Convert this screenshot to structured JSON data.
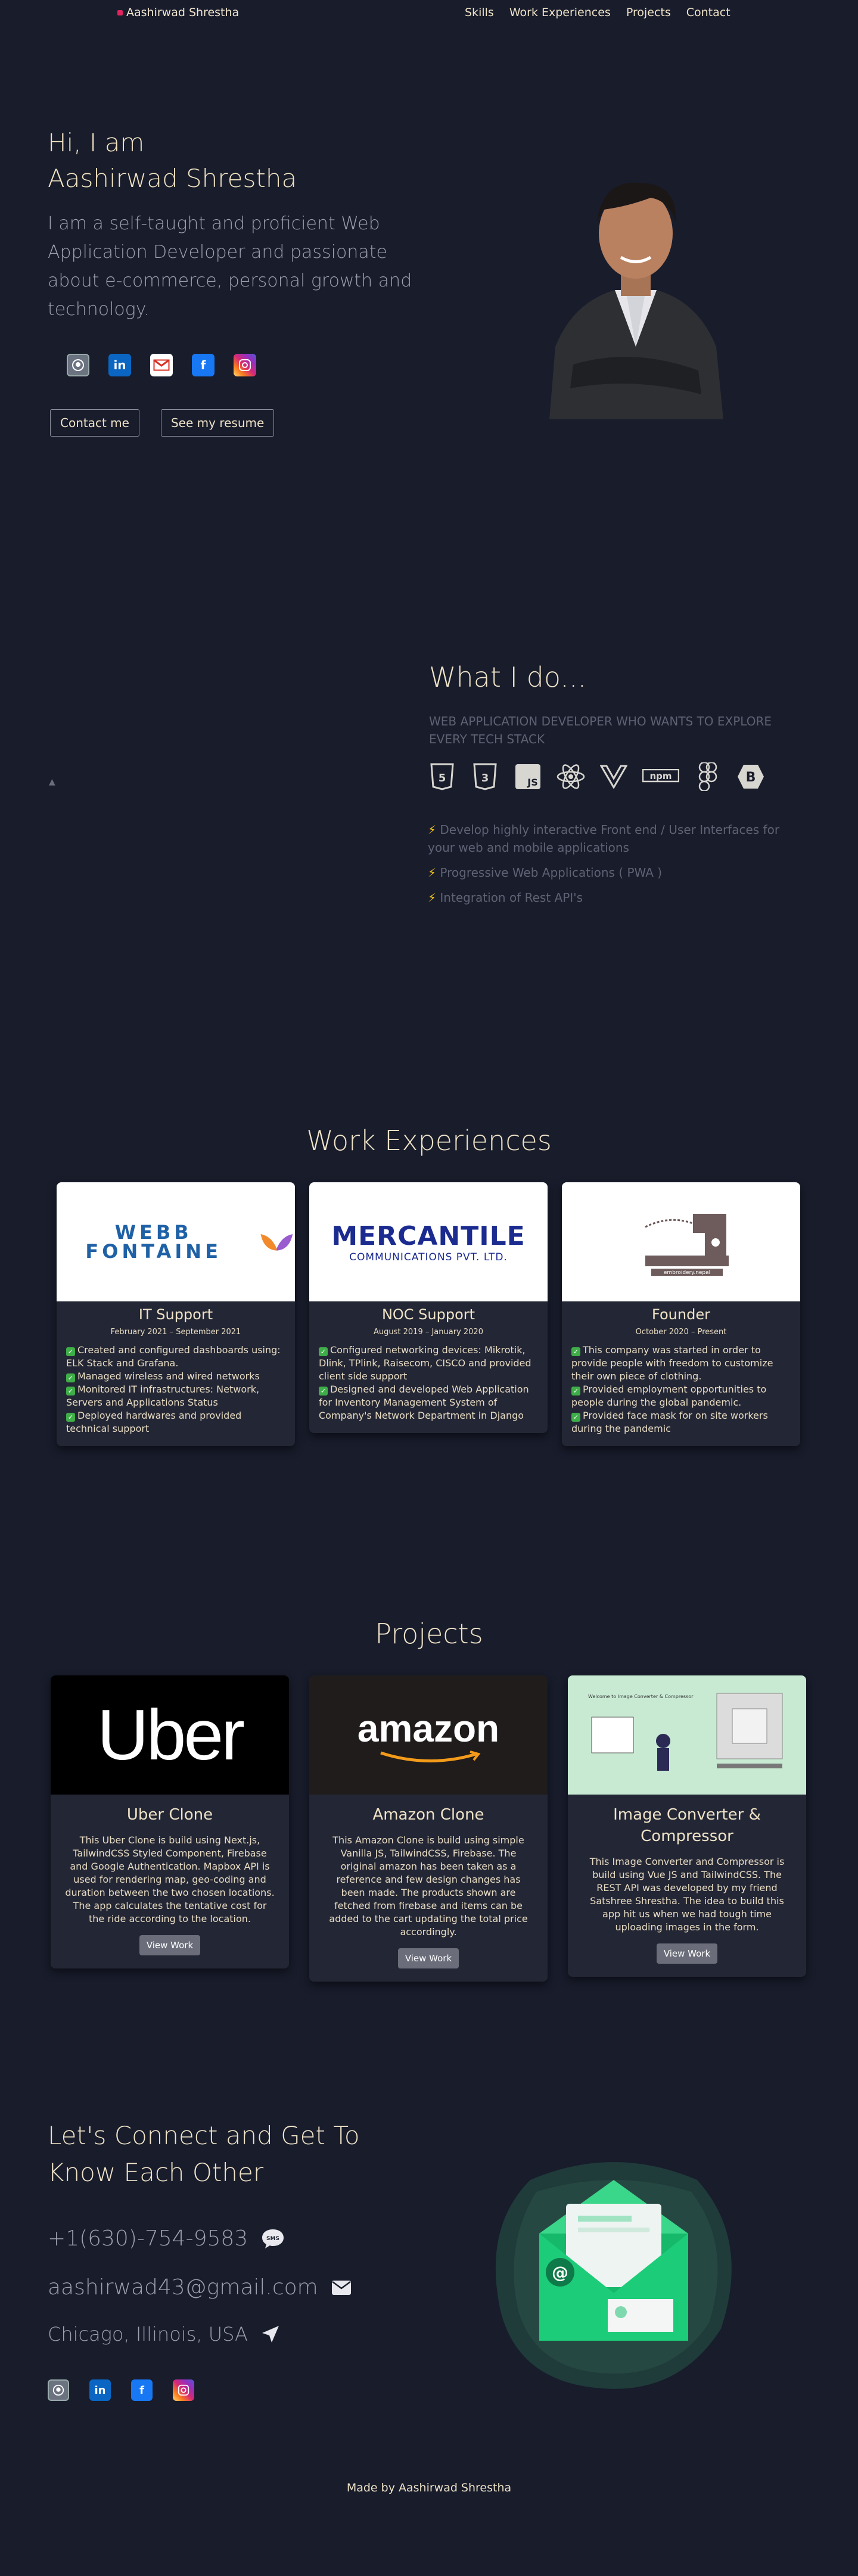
{
  "nav": {
    "brand": "Aashirwad Shrestha",
    "links": [
      "Skills",
      "Work Experiences",
      "Projects",
      "Contact"
    ]
  },
  "hero": {
    "greeting": "Hi, I am",
    "name": "Aashirwad Shrestha",
    "description": "I am a self-taught and proficient Web Application Developer and passionate about e-commerce, personal growth and technology.",
    "buttons": {
      "contact": "Contact me",
      "resume": "See my resume"
    },
    "socials": [
      "github-icon",
      "linkedin-icon",
      "gmail-icon",
      "facebook-icon",
      "instagram-icon"
    ]
  },
  "what_i_do": {
    "title": "What I do...",
    "subtitle": "WEB APPLICATION DEVELOPER WHO WANTS TO EXPLORE EVERY TECH STACK",
    "stack_icons": [
      "html5-icon",
      "css3-icon",
      "javascript-icon",
      "react-icon",
      "vue-icon",
      "npm-icon",
      "figma-icon",
      "bootstrap-icon"
    ],
    "stack_labels": {
      "html": "5",
      "css": "3",
      "js": "JS",
      "npm": "npm",
      "bootstrap": "B"
    },
    "bullets": [
      "Develop highly interactive Front end / User Interfaces for your web and mobile applications",
      "Progressive Web Applications ( PWA )",
      "Integration of Rest API's"
    ]
  },
  "work": {
    "title": "Work Experiences",
    "items": [
      {
        "company_logo": "WEBB FONTAINE",
        "role": "IT Support",
        "dates": "February 2021 – September 2021",
        "points": [
          "Created and configured dashboards using: ELK Stack and Grafana.",
          "Managed wireless and wired networks",
          "Monitored IT infrastructures: Network, Servers and Applications Status",
          "Deployed hardwares and provided technical support"
        ]
      },
      {
        "company_logo": "MERCANTILE",
        "company_logo_sub": "COMMUNICATIONS PVT. LTD.",
        "role": "NOC Support",
        "dates": "August 2019 – January 2020",
        "points": [
          "Configured networking devices: Mikrotik, Dlink, TPlink, Raisecom, CISCO and provided client side support",
          "Designed and developed Web Application for Inventory Management System of Company's Network Department in Django"
        ]
      },
      {
        "company_logo": "embroidery.nepal",
        "role": "Founder",
        "dates": "October 2020 – Present",
        "points": [
          "This company was started in order to provide people with freedom to customize their own piece of clothing.",
          "Provided employment opportunities to people during the global pandemic.",
          "Provided face mask for on site workers during the pandemic"
        ]
      }
    ]
  },
  "projects": {
    "title": "Projects",
    "items": [
      {
        "thumb_text": "Uber",
        "title": "Uber Clone",
        "description": "This Uber Clone is build using Next.js, TailwindCSS Styled Component, Firebase and Google Authentication. Mapbox API is used for rendering map, geo-coding and duration between the two chosen locations. The app calculates the tentative cost for the ride according to the location.",
        "button": "View Work"
      },
      {
        "thumb_text": "amazon",
        "title": "Amazon Clone",
        "description": "This Amazon Clone is build using simple Vanilla JS, TailwindCSS, Firebase. The original amazon has been taken as a reference and few design changes has been made. The products shown are fetched from firebase and items can be added to the cart updating the total price accordingly.",
        "button": "View Work"
      },
      {
        "thumb_text": "Welcome to Image Converter & Compressor",
        "title": "Image Converter & Compressor",
        "description": "This Image Converter and Compressor is build using Vue JS and TailwindCSS. The REST API was developed by my friend Satshree Shrestha. The idea to build this app hit us when we had tough time uploading images in the form.",
        "button": "View Work"
      }
    ]
  },
  "contact": {
    "title": "Let's Connect and Get To Know Each Other",
    "phone": "+1(630)-754-9583",
    "email": "aashirwad43@gmail.com",
    "location": "Chicago, Illinois, USA",
    "sms_label": "SMS",
    "socials": [
      "github-icon",
      "linkedin-icon",
      "facebook-icon",
      "instagram-icon"
    ]
  },
  "footer": "Made by Aashirwad Shrestha"
}
